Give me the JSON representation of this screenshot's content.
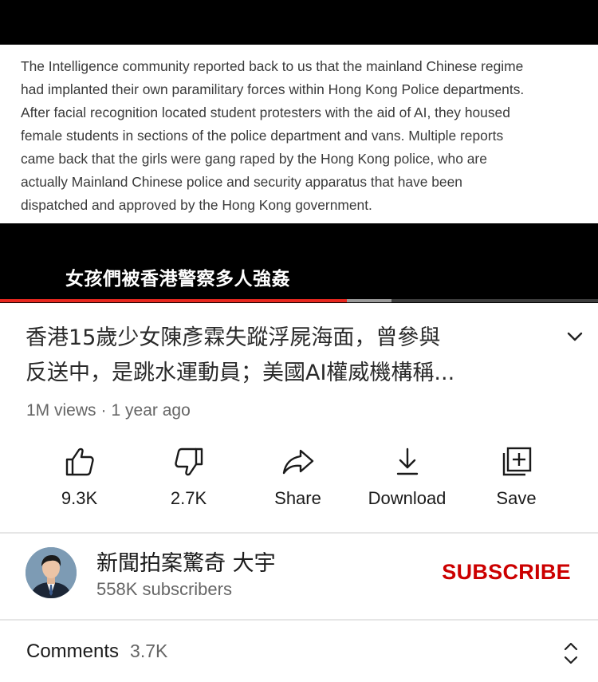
{
  "player": {
    "document_lines": [
      "The Intelligence community reported back to us that the mainland Chinese regime",
      "had implanted their own paramilitary forces within Hong Kong Police departments.",
      "After facial recognition located student protesters with the aid of AI, they housed",
      "female students in sections of the police department and vans. Multiple reports",
      "came back that the girls were gang raped by the Hong Kong police, who are",
      "actually Mainland Chinese police and security apparatus that have been",
      "dispatched and approved by the Hong Kong government."
    ],
    "caption": "女孩們被香港警察多人強姦",
    "progress_played": 0.58,
    "progress_buffered": 0.655,
    "played_color": "#e8271f"
  },
  "video": {
    "title_line1": "香港15歲少女陳彥霖失蹤浮屍海面，曾參與",
    "title_line2": "反送中，是跳水運動員；美國AI權威機構稱...",
    "views": "1M views",
    "separator": "·",
    "age": "1 year ago",
    "expand_icon": "chevron-down-icon"
  },
  "actions": [
    {
      "id": "like",
      "icon": "thumbs-up-icon",
      "label": "9.3K"
    },
    {
      "id": "dislike",
      "icon": "thumbs-down-icon",
      "label": "2.7K"
    },
    {
      "id": "share",
      "icon": "share-icon",
      "label": "Share"
    },
    {
      "id": "download",
      "icon": "download-icon",
      "label": "Download"
    },
    {
      "id": "save",
      "icon": "save-playlist-icon",
      "label": "Save"
    }
  ],
  "channel": {
    "name": "新聞拍案驚奇 大宇",
    "subscribers": "558K subscribers",
    "subscribe_label": "SUBSCRIBE",
    "subscribe_color": "#cc0000"
  },
  "comments": {
    "label": "Comments",
    "count": "3.7K",
    "sort_icon": "unfold-icon"
  }
}
